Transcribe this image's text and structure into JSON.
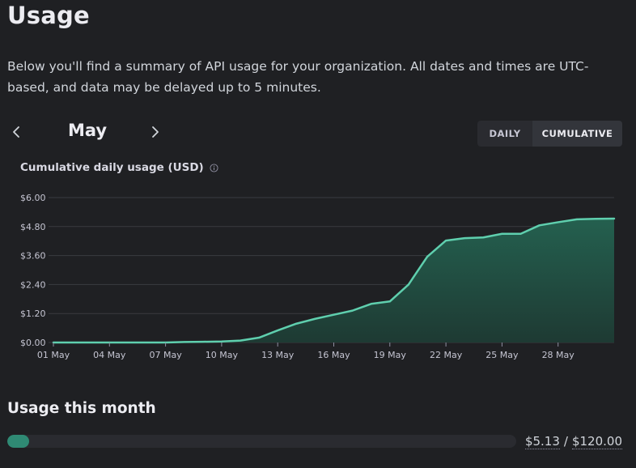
{
  "page": {
    "title": "Usage",
    "description": "Below you'll find a summary of API usage for your organization. All dates and times are UTC-based, and data may be delayed up to 5 minutes."
  },
  "nav": {
    "month": "May",
    "prev_icon": "chevron-left-icon",
    "next_icon": "chevron-right-icon"
  },
  "view_toggle": {
    "options": [
      "DAILY",
      "CUMULATIVE"
    ],
    "selected": "CUMULATIVE"
  },
  "chart_section": {
    "title": "Cumulative daily usage (USD)",
    "info_icon": "info-icon"
  },
  "chart_data": {
    "type": "area",
    "title": "Cumulative daily usage (USD)",
    "x_tick_labels": [
      "01 May",
      "04 May",
      "07 May",
      "10 May",
      "13 May",
      "16 May",
      "19 May",
      "22 May",
      "25 May",
      "28 May"
    ],
    "y_tick_labels": [
      "$0.00",
      "$1.20",
      "$2.40",
      "$3.60",
      "$4.80",
      "$6.00"
    ],
    "ylim": [
      0,
      6.0
    ],
    "grid": true,
    "series": [
      {
        "x": [
          "01 May",
          "02 May",
          "03 May",
          "04 May",
          "05 May",
          "06 May",
          "07 May",
          "08 May",
          "09 May",
          "10 May",
          "11 May",
          "12 May",
          "13 May",
          "14 May",
          "15 May",
          "16 May",
          "17 May",
          "18 May",
          "19 May",
          "20 May",
          "21 May",
          "22 May",
          "23 May",
          "24 May",
          "25 May",
          "26 May",
          "27 May",
          "28 May",
          "29 May",
          "30 May",
          "31 May"
        ],
        "values": [
          0.0,
          0.0,
          0.0,
          0.0,
          0.0,
          0.0,
          0.0,
          0.02,
          0.03,
          0.04,
          0.08,
          0.2,
          0.5,
          0.78,
          0.98,
          1.15,
          1.32,
          1.6,
          1.7,
          2.4,
          3.55,
          4.22,
          4.32,
          4.35,
          4.5,
          4.5,
          4.85,
          4.98,
          5.1,
          5.12,
          5.13
        ]
      }
    ],
    "colors": {
      "line": "#5fcfae",
      "fill_top": "#24604f",
      "fill_bottom": "#1e3a33",
      "grid": "#3a3b40"
    }
  },
  "usage_month": {
    "title": "Usage this month",
    "used": "$5.13",
    "separator": "/",
    "limit": "$120.00",
    "fraction": 0.04275
  }
}
